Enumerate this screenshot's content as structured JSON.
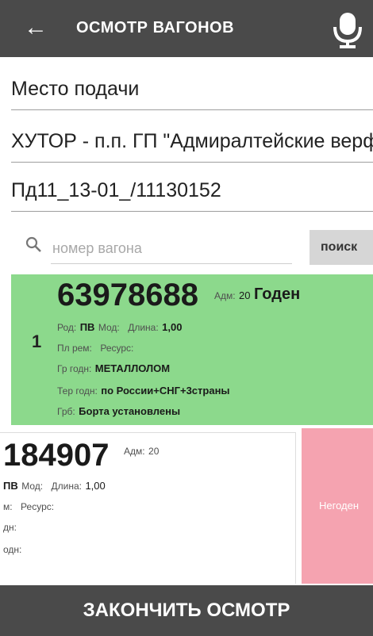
{
  "header": {
    "title": "ОСМОТР ВАГОНОВ",
    "back_icon": "arrow-left-icon",
    "mic_icon": "microphone-icon"
  },
  "fields": {
    "place_label": "Место подачи",
    "location": "ХУТОР - п.п. ГП \"Адмиралтейские верф",
    "document": "Пд11_13-01_/11130152"
  },
  "search": {
    "placeholder": "номер вагона",
    "button_label": "поиск"
  },
  "wagons": [
    {
      "index": "1",
      "number": "63978688",
      "adm_label": "Адм:",
      "adm_value": "20",
      "status": "Годен",
      "rod_label": "Род:",
      "rod_value": "ПВ",
      "mod_label": "Мод:",
      "length_label": "Длина:",
      "length_value": "1,00",
      "plrem_label": "Пл рем:",
      "resource_label": "Ресурс:",
      "cargo_label": "Гр годн:",
      "cargo_value": "МЕТАЛЛОЛОМ",
      "territory_label": "Тер годн:",
      "territory_value": "по России+СНГ+3страны",
      "grb_label": "Грб:",
      "grb_value": "Борта установлены",
      "color": "#8cd98c"
    },
    {
      "number": "184907",
      "adm_label": "Адм:",
      "adm_value": "20",
      "rod_value": "ПВ",
      "mod_label": "Мод:",
      "length_label": "Длина:",
      "length_value": "1,00",
      "plrem_label": "м:",
      "resource_label": "Ресурс:",
      "cargo_label": "дн:",
      "territory_label": "одн:",
      "status_panel": "Негоден",
      "color": "#f5a3b0"
    }
  ],
  "footer": {
    "finish_label": "ЗАКОНЧИТЬ ОСМОТР"
  }
}
